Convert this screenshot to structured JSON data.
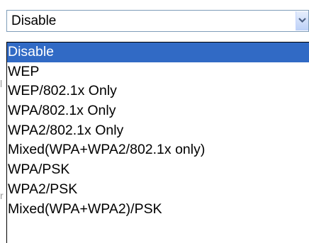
{
  "select": {
    "current_value": "Disable",
    "arrow_icon": "chevron-down-icon"
  },
  "dropdown": {
    "options": [
      "Disable",
      "WEP",
      "WEP/802.1x Only",
      "WPA/802.1x Only",
      "WPA2/802.1x Only",
      "Mixed(WPA+WPA2/802.1x only)",
      "WPA/PSK",
      "WPA2/PSK",
      "Mixed(WPA+WPA2)/PSK"
    ],
    "selected_index": 0
  },
  "colors": {
    "highlight": "#316ac5",
    "select_border": "#7f9db9"
  }
}
